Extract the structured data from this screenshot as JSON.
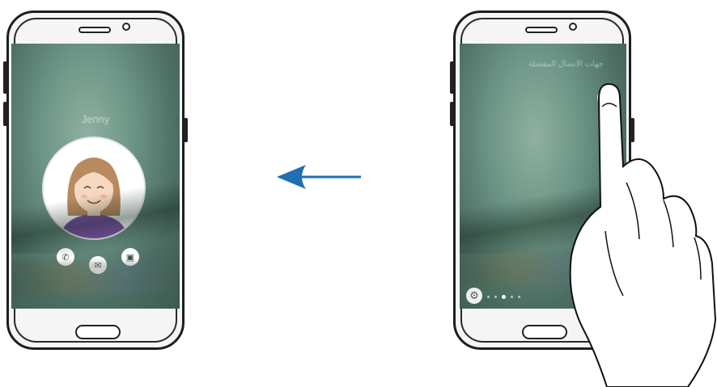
{
  "left_screen": {
    "contact_name": "Jenny",
    "actions": [
      "call-icon",
      "message-icon",
      "video-icon"
    ]
  },
  "right_screen": {
    "edge_title": "جهات الاتصال المفضلة",
    "page_indicator": {
      "pages": 5,
      "active": 3
    }
  },
  "arrow": {
    "direction": "left",
    "color": "#1f6fb5"
  }
}
